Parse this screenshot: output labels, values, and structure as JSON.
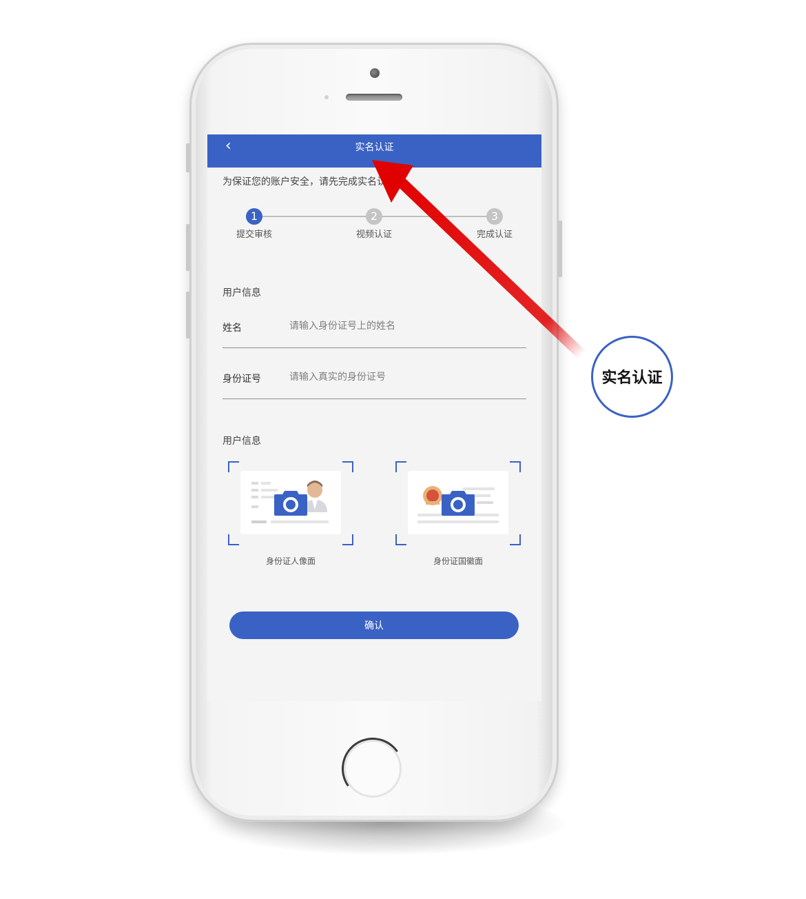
{
  "navbar": {
    "back_icon": "chevron-left-icon",
    "back_glyph": "‹",
    "title": "实名认证"
  },
  "notice": "为保证您的账户安全，请先完成实名认证",
  "steps": [
    {
      "number": "1",
      "label": "提交审核",
      "active": true
    },
    {
      "number": "2",
      "label": "视频认证",
      "active": false
    },
    {
      "number": "3",
      "label": "完成认证",
      "active": false
    }
  ],
  "user_info": {
    "section_title": "用户信息",
    "name": {
      "label": "姓名",
      "placeholder": "请输入身份证号上的姓名"
    },
    "id_number": {
      "label": "身份证号",
      "placeholder": "请输入真实的身份证号"
    }
  },
  "photos": {
    "section_title": "用户信息",
    "front_label": "身份证人像面",
    "back_label": "身份证国徽面",
    "icon": "camera-icon"
  },
  "confirm_label": "确认",
  "callout": {
    "text": "实名认证"
  },
  "colors": {
    "primary": "#3a62c4",
    "active_step": "#3a62c4",
    "inactive_step": "#c4c4c4",
    "arrow": "#e10000"
  }
}
